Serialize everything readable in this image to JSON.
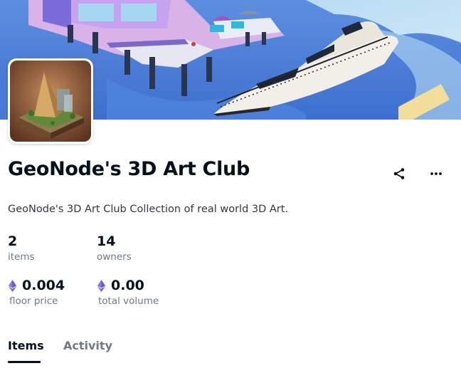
{
  "collection": {
    "name": "GeoNode's 3D Art Club",
    "description": "GeoNode's 3D Art Club Collection of real world 3D Art."
  },
  "stats": {
    "items": {
      "value": "2",
      "label": "items"
    },
    "owners": {
      "value": "14",
      "label": "owners"
    },
    "floor_price": {
      "value": "0.004",
      "label": "floor price",
      "icon": "ethereum-icon"
    },
    "total_volume": {
      "value": "0.00",
      "label": "total volume",
      "icon": "ethereum-icon"
    }
  },
  "actions": {
    "share_icon": "share-icon",
    "more_icon": "more-horizontal-icon"
  },
  "tabs": [
    {
      "label": "Items",
      "active": true
    },
    {
      "label": "Activity",
      "active": false
    }
  ],
  "colors": {
    "text_primary": "#04111d",
    "text_secondary": "#707a83",
    "ethereum": "#6f52d9"
  }
}
